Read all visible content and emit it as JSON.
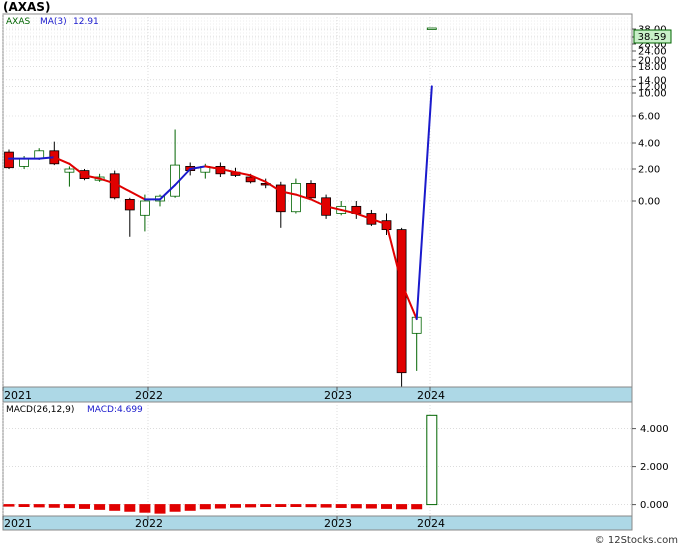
{
  "title": "(AXAS)",
  "credit": "© 12Stocks.com",
  "colors": {
    "up": "#006400",
    "down": "#e00000",
    "ma_down": "#e00000",
    "ma_up": "#1a1acc",
    "axis_band": "#add8e6",
    "grid": "#c8c8c8",
    "price_badge_bg": "#c8f0c8"
  },
  "chart_data": [
    {
      "type": "candlestick",
      "legend": {
        "ticker": "AXAS",
        "ma_label": "MA(3)",
        "ma_value": "12.91"
      },
      "last_price": "38.59",
      "y_tick_labels": [
        "38.00",
        "32.00",
        "28.00",
        "24.00",
        "20.00",
        "18.00",
        "14.00",
        "12.00",
        "10.00",
        "6.00",
        "4.00",
        "2.00",
        "0.00"
      ],
      "x_tick_labels": [
        "2021",
        "2022",
        "2023",
        "2024"
      ],
      "candles": [
        {
          "o": 3.3,
          "h": 3.5,
          "l": 2.0,
          "c": 2.1
        },
        {
          "o": 2.2,
          "h": 3.0,
          "l": 2.0,
          "c": 2.8
        },
        {
          "o": 2.8,
          "h": 3.6,
          "l": 2.7,
          "c": 3.4
        },
        {
          "o": 3.4,
          "h": 4.1,
          "l": 2.3,
          "c": 2.4
        },
        {
          "o": 1.8,
          "h": 2.2,
          "l": 0.9,
          "c": 2.0
        },
        {
          "o": 1.9,
          "h": 2.0,
          "l": 1.3,
          "c": 1.4
        },
        {
          "o": 1.3,
          "h": 1.7,
          "l": 1.2,
          "c": 1.5
        },
        {
          "o": 1.7,
          "h": 1.9,
          "l": 0.1,
          "c": 0.2
        },
        {
          "o": 0.1,
          "h": 0.2,
          "l": -2.0,
          "c": -0.5
        },
        {
          "o": -0.8,
          "h": 0.4,
          "l": -1.7,
          "c": 0.0
        },
        {
          "o": 0.0,
          "h": 0.4,
          "l": -0.3,
          "c": 0.3
        },
        {
          "o": 0.3,
          "h": 5.0,
          "l": 0.2,
          "c": 2.3
        },
        {
          "o": 2.2,
          "h": 2.5,
          "l": 1.6,
          "c": 1.9
        },
        {
          "o": 1.8,
          "h": 2.4,
          "l": 1.4,
          "c": 2.2
        },
        {
          "o": 2.2,
          "h": 2.5,
          "l": 1.5,
          "c": 1.7
        },
        {
          "o": 1.8,
          "h": 2.1,
          "l": 1.5,
          "c": 1.6
        },
        {
          "o": 1.5,
          "h": 1.7,
          "l": 1.1,
          "c": 1.2
        },
        {
          "o": 1.1,
          "h": 1.4,
          "l": 0.8,
          "c": 1.0
        },
        {
          "o": 1.0,
          "h": 1.2,
          "l": -1.5,
          "c": -0.6
        },
        {
          "o": -0.6,
          "h": 1.4,
          "l": -0.7,
          "c": 1.1
        },
        {
          "o": 1.1,
          "h": 1.3,
          "l": 0.1,
          "c": 0.2
        },
        {
          "o": 0.2,
          "h": 0.4,
          "l": -1.0,
          "c": -0.8
        },
        {
          "o": -0.7,
          "h": 0.0,
          "l": -0.8,
          "c": -0.3
        },
        {
          "o": -0.3,
          "h": 0.0,
          "l": -1.0,
          "c": -0.7
        },
        {
          "o": -0.7,
          "h": -0.5,
          "l": -1.4,
          "c": -1.3
        },
        {
          "o": -1.1,
          "h": -0.7,
          "l": -1.9,
          "c": -1.6
        },
        {
          "o": -1.6,
          "h": -1.5,
          "l": -10.4,
          "c": -9.6
        },
        {
          "o": -7.4,
          "h": -6.5,
          "l": -9.5,
          "c": -6.5
        },
        {
          "o": 38.0,
          "h": 38.3,
          "l": 37.9,
          "c": 38.3
        }
      ],
      "ma_line": [
        2.8,
        2.8,
        2.8,
        2.9,
        2.4,
        1.6,
        1.4,
        1.1,
        0.6,
        0.1,
        0.1,
        1.0,
        2.0,
        2.2,
        2.0,
        1.8,
        1.6,
        1.2,
        0.6,
        0.4,
        0.1,
        -0.3,
        -0.5,
        -0.7,
        -1.0,
        -1.3,
        -4.6,
        -6.6,
        12.0
      ]
    },
    {
      "type": "bar",
      "legend": {
        "label": "MACD(26,12,9)",
        "value_label": "MACD:4.699"
      },
      "y_tick_labels": [
        "4.000",
        "2.000",
        "0.000"
      ],
      "x_tick_labels": [
        "2021",
        "2022",
        "2023",
        "2024"
      ],
      "ylim": [
        -0.6,
        5.4
      ],
      "values": [
        -0.08,
        -0.1,
        -0.12,
        -0.14,
        -0.16,
        -0.2,
        -0.25,
        -0.3,
        -0.35,
        -0.4,
        -0.45,
        -0.35,
        -0.3,
        -0.22,
        -0.18,
        -0.14,
        -0.12,
        -0.1,
        -0.1,
        -0.1,
        -0.11,
        -0.13,
        -0.15,
        -0.17,
        -0.18,
        -0.2,
        -0.22,
        -0.22,
        4.699
      ]
    }
  ]
}
